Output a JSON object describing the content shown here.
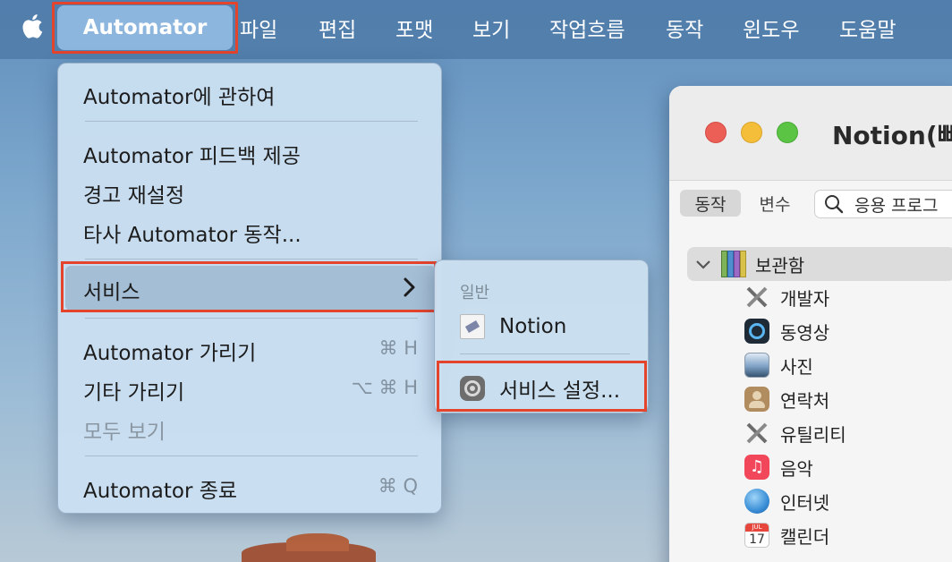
{
  "menubar": {
    "app_name": "Automator",
    "items": [
      "파일",
      "편집",
      "포맷",
      "보기",
      "작업흐름",
      "동작",
      "윈도우",
      "도움말"
    ]
  },
  "dropdown": {
    "about": "Automator에 관하여",
    "feedback": "Automator 피드백 제공",
    "reset_warnings": "경고 재설정",
    "third_party": "타사 Automator 동작...",
    "services": "서비스",
    "hide_app": "Automator 가리기",
    "hide_app_shortcut": "⌘ H",
    "hide_others": "기타 가리기",
    "hide_others_shortcut": "⌥ ⌘ H",
    "show_all": "모두 보기",
    "quit": "Automator 종료",
    "quit_shortcut": "⌘ Q"
  },
  "submenu": {
    "header": "일반",
    "notion": "Notion",
    "service_settings": "서비스 설정..."
  },
  "window": {
    "title": "Notion(빠",
    "tab_actions": "동작",
    "tab_variables": "변수",
    "search_placeholder": "응용 프로그",
    "library_root": "보관함",
    "library_items": [
      "개발자",
      "동영상",
      "사진",
      "연락처",
      "유틸리티",
      "음악",
      "인터넷",
      "캘린더"
    ],
    "calendar_month": "JUL",
    "calendar_day": "17"
  },
  "colors": {
    "highlight_box": "#e4432c",
    "menubar_bg": "#507daa",
    "menu_bg": "#cadff0"
  }
}
